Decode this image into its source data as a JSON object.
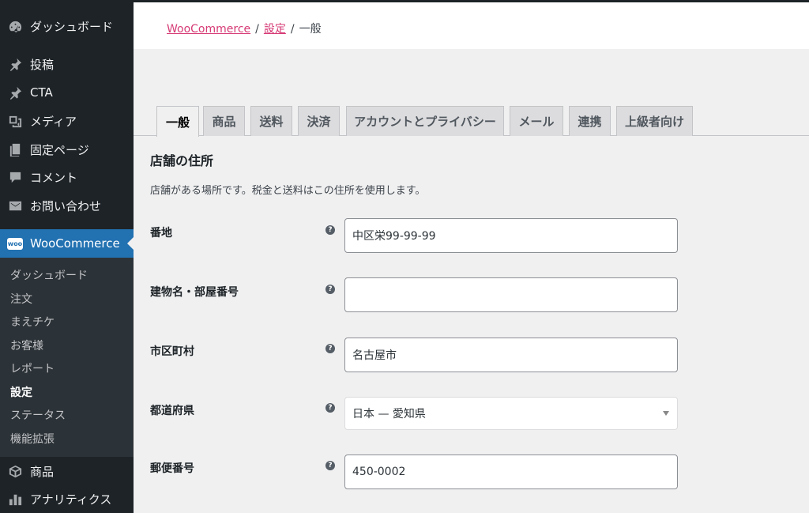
{
  "sidebar": {
    "top_items": [
      {
        "label": "ダッシュボード",
        "icon": "dashboard-icon"
      },
      {
        "label": "投稿",
        "icon": "pin-icon"
      },
      {
        "label": "CTA",
        "icon": "pin-icon"
      },
      {
        "label": "メディア",
        "icon": "media-icon"
      },
      {
        "label": "固定ページ",
        "icon": "page-icon"
      },
      {
        "label": "コメント",
        "icon": "comment-icon"
      },
      {
        "label": "お問い合わせ",
        "icon": "mail-icon"
      }
    ],
    "current": {
      "label": "WooCommerce",
      "icon": "woo-icon",
      "icon_text": "woo"
    },
    "submenu": [
      "ダッシュボード",
      "注文",
      "まえチケ",
      "お客様",
      "レポート",
      "設定",
      "ステータス",
      "機能拡張"
    ],
    "bottom_items": [
      {
        "label": "商品",
        "icon": "box-icon"
      },
      {
        "label": "アナリティクス",
        "icon": "bar-chart-icon"
      }
    ]
  },
  "breadcrumb": {
    "items": [
      "WooCommerce",
      "設定"
    ],
    "current": "一般",
    "separator": "/"
  },
  "tabs": [
    "一般",
    "商品",
    "送料",
    "決済",
    "アカウントとプライバシー",
    "メール",
    "連携",
    "上級者向け"
  ],
  "section": {
    "title": "店舗の住所",
    "description": "店舗がある場所です。税金と送料はこの住所を使用します。"
  },
  "fields": [
    {
      "label": "番地",
      "value": "中区栄99-99-99",
      "type": "text"
    },
    {
      "label": "建物名・部屋番号",
      "value": "",
      "type": "text"
    },
    {
      "label": "市区町村",
      "value": "名古屋市",
      "type": "text"
    },
    {
      "label": "都道府県",
      "value": "日本 — 愛知県",
      "type": "select"
    },
    {
      "label": "郵便番号",
      "value": "450-0002",
      "type": "text"
    }
  ],
  "help_glyph": "?",
  "colors": {
    "accent": "#2271b1",
    "link": "#d63a75",
    "sidebar": "#1d2327"
  }
}
